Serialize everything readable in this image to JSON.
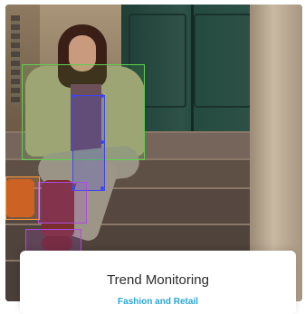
{
  "card": {
    "title": "Trend Monitoring",
    "subtitle": "Fashion and Retail"
  },
  "image": {
    "subject": "fashion-photo-with-detection-boxes",
    "overlay_colors": {
      "green": "#5fd04f",
      "blue": "#3f46e8",
      "purple": "#b04be0",
      "orange": "#ff9a3c"
    }
  },
  "accent_color": "#27a7d9"
}
